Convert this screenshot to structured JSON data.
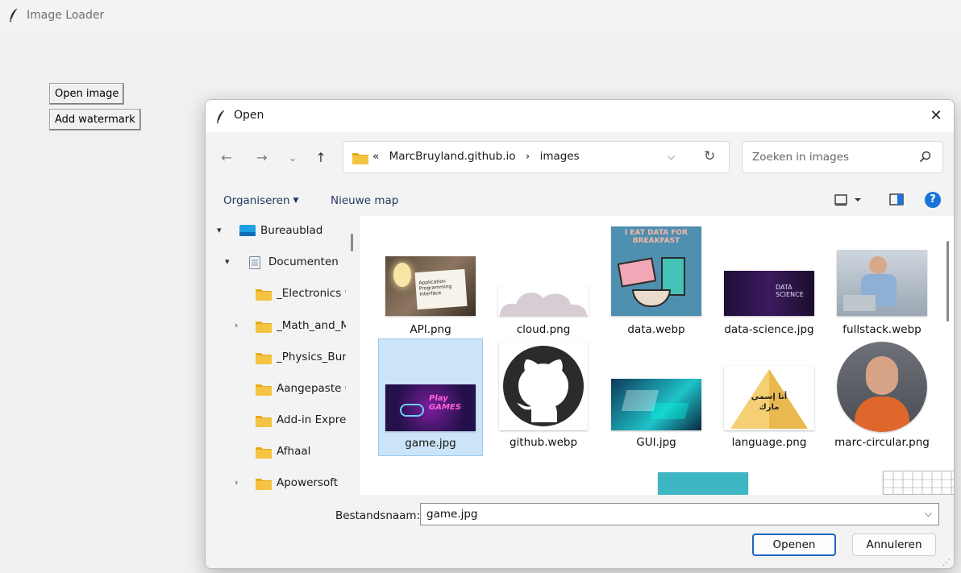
{
  "app": {
    "title": "Image Loader"
  },
  "main_buttons": {
    "open_image": "Open image",
    "add_watermark": "Add watermark"
  },
  "dialog": {
    "title": "Open",
    "nav": {
      "back": "←",
      "forward": "→",
      "recent": "⌄",
      "up": "↑"
    },
    "address": {
      "prefix": "«",
      "crumbs": [
        "MarcBruyland.github.io",
        "›",
        "images"
      ]
    },
    "search": {
      "placeholder": "Zoeken in images"
    },
    "commands": {
      "organize": "Organiseren",
      "new_folder": "Nieuwe map"
    },
    "sidebar": [
      {
        "label": "Bureaublad",
        "expanded": true,
        "icon": "desktop-icon"
      },
      {
        "label": "Documenten",
        "expanded": true,
        "icon": "document-icon"
      },
      {
        "label": "_Electronics with Python",
        "icon": "folder-icon"
      },
      {
        "label": "_Math_and_Machine_Learning",
        "collapsed": true,
        "icon": "folder-icon"
      },
      {
        "label": "_Physics_Bureau",
        "icon": "folder-icon"
      },
      {
        "label": "Aangepaste Office-sjablonen",
        "icon": "folder-icon"
      },
      {
        "label": "Add-in Express",
        "icon": "folder-icon"
      },
      {
        "label": "Afhaal",
        "icon": "folder-icon"
      },
      {
        "label": "Apowersoft",
        "collapsed": true,
        "icon": "folder-icon"
      }
    ],
    "files": [
      {
        "name": "API.png",
        "thumb_text": [
          "Application",
          "Programming",
          "Interface"
        ]
      },
      {
        "name": "cloud.png"
      },
      {
        "name": "data.webp",
        "thumb_text": [
          "I EAT DATA FOR",
          "BREAKFAST"
        ]
      },
      {
        "name": "data-science.jpg",
        "thumb_text": [
          "DATA",
          "SCIENCE"
        ]
      },
      {
        "name": "fullstack.webp"
      },
      {
        "name": "game.jpg",
        "selected": true,
        "thumb_text": [
          "Play",
          "GAMES"
        ]
      },
      {
        "name": "github.webp"
      },
      {
        "name": "GUI.jpg"
      },
      {
        "name": "language.png",
        "thumb_text": [
          "أنا إسمي",
          "مارك"
        ]
      },
      {
        "name": "marc-circular.png"
      }
    ],
    "filename": {
      "label": "Bestandsnaam:",
      "value": "game.jpg"
    },
    "buttons": {
      "open": "Openen",
      "cancel": "Annuleren"
    },
    "colors": {
      "accent": "#1a66c0",
      "selection": "#cce4f7",
      "help": "#1a73d9",
      "folder": "#f5c342"
    }
  }
}
